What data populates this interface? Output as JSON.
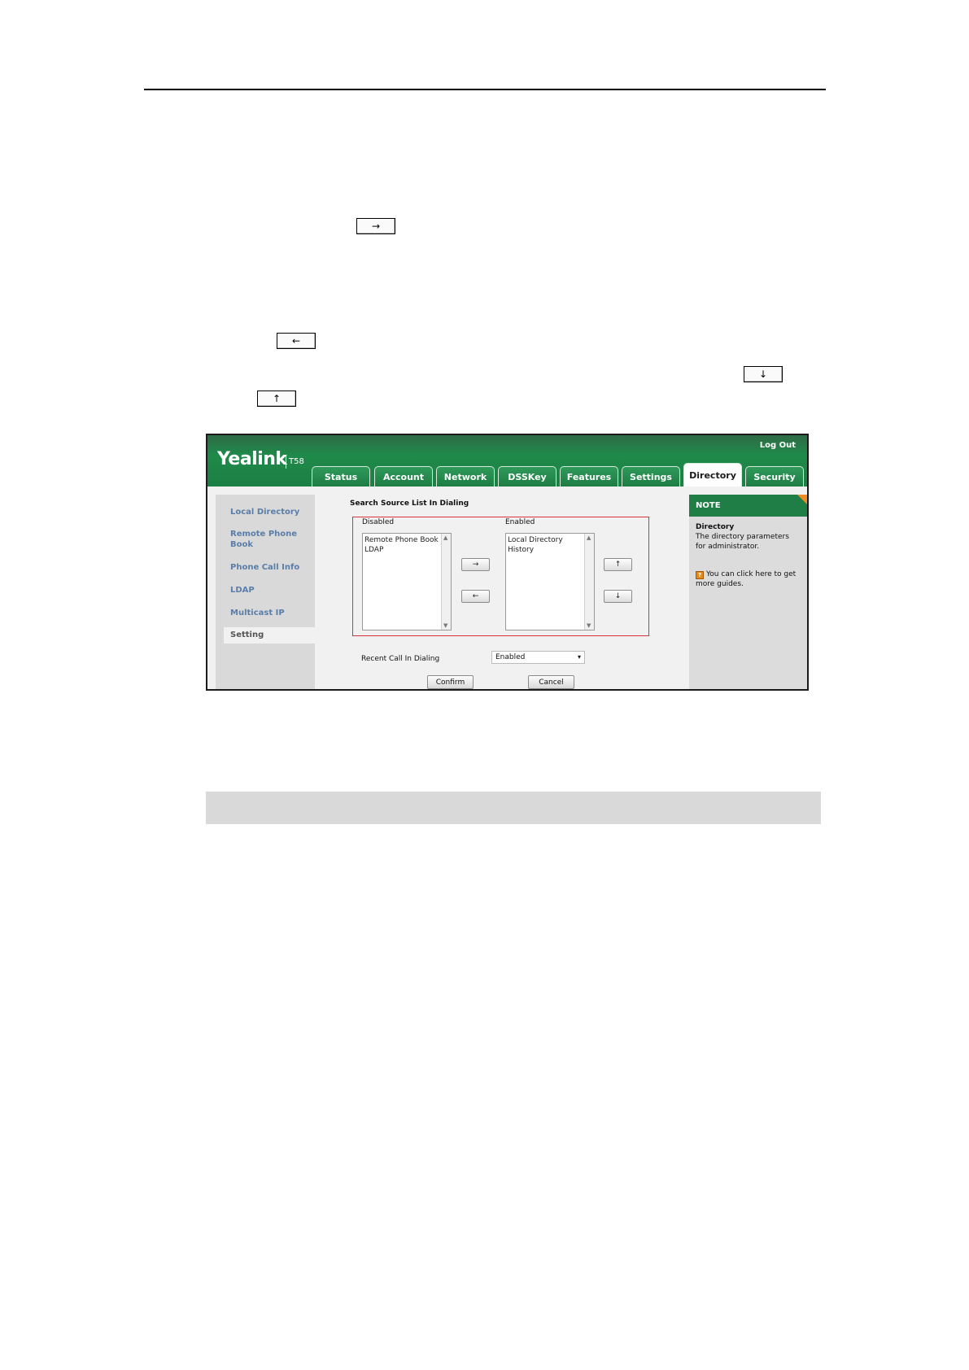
{
  "inline_keys": {
    "right": "→",
    "left": "←",
    "down": "↓",
    "up": "↑"
  },
  "screenshot": {
    "log_out": "Log Out",
    "brand": "Yealink",
    "model": "T58",
    "tabs": [
      "Status",
      "Account",
      "Network",
      "DSSKey",
      "Features",
      "Settings",
      "Directory",
      "Security"
    ],
    "active_tab": "Directory",
    "sidebar": [
      "Local Directory",
      "Remote Phone Book",
      "Phone Call Info",
      "LDAP",
      "Multicast IP",
      "Setting"
    ],
    "section_title": "Search Source List In Dialing",
    "disabled_label": "Disabled",
    "enabled_label": "Enabled",
    "disabled_items": [
      "Remote Phone Book",
      "LDAP"
    ],
    "enabled_items": [
      "Local Directory",
      "History"
    ],
    "move_right": "→",
    "move_left": "←",
    "move_up": "↑",
    "move_down": "↓",
    "recent_call_label": "Recent Call In Dialing",
    "recent_call_value": "Enabled",
    "confirm": "Confirm",
    "cancel": "Cancel",
    "note": {
      "header": "NOTE",
      "title": "Directory",
      "body": "The directory parameters for administrator.",
      "link": "You can click here to get more guides."
    }
  },
  "colors": {
    "brand_green": "#1f7e46",
    "highlight_red": "#d8323c",
    "sidebar_link": "#5a7ea8"
  }
}
